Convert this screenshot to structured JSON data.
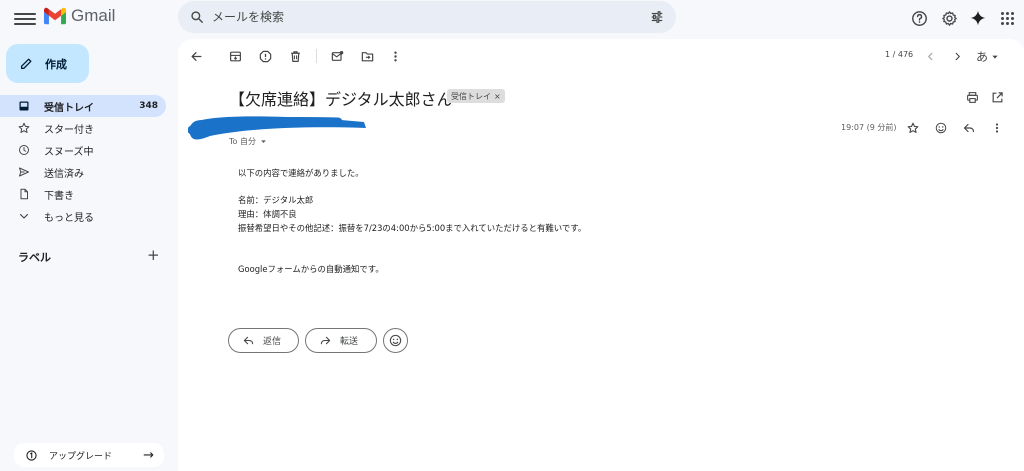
{
  "header": {
    "app_name": "Gmail",
    "search_placeholder": "メールを検索"
  },
  "sidebar": {
    "compose_label": "作成",
    "items": [
      {
        "label": "受信トレイ",
        "count": "348",
        "icon": "inbox-icon"
      },
      {
        "label": "スター付き",
        "icon": "star-icon"
      },
      {
        "label": "スヌーズ中",
        "icon": "clock-icon"
      },
      {
        "label": "送信済み",
        "icon": "send-icon"
      },
      {
        "label": "下書き",
        "icon": "draft-icon"
      },
      {
        "label": "もっと見る",
        "icon": "chevron-down-icon"
      }
    ],
    "labels_title": "ラベル",
    "labels_add": "+",
    "upgrade_label": "アップグレード"
  },
  "toolbar": {
    "pager": "1 / 476",
    "language": "あ"
  },
  "message": {
    "subject": "【欠席連絡】デジタル太郎さん",
    "label_chip": "受信トレイ",
    "label_chip_close": "×",
    "to_line": "To 自分",
    "time": "19:07 (9 分前)",
    "body": [
      "以下の内容で連絡がありました。",
      "名前：デジタル太郎",
      "理由：体調不良",
      "振替希望日やその他記述：振替を7/23の4:00から5:00まで入れていただけると有難いです。",
      "Googleフォームからの自動通知です。"
    ]
  },
  "actions": {
    "reply": "返信",
    "forward": "転送"
  },
  "colors": {
    "background": "#f6f8fc",
    "compose": "#c2e7ff",
    "active_nav": "#d3e3fd",
    "search": "#e9eef6",
    "redaction": "#1a73c8"
  }
}
